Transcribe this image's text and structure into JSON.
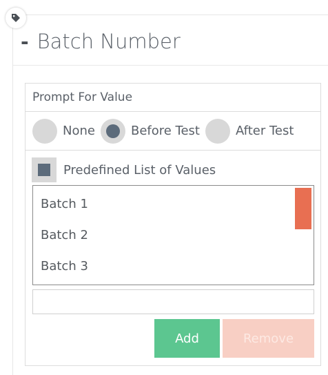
{
  "section": {
    "collapse_symbol": "-",
    "title": "Batch Number",
    "icon": "tag-icon"
  },
  "prompt": {
    "label": "Prompt For Value",
    "options": [
      {
        "label": "None",
        "selected": false
      },
      {
        "label": "Before Test",
        "selected": true
      },
      {
        "label": "After Test",
        "selected": false
      }
    ]
  },
  "predefined": {
    "label": "Predefined List of Values",
    "checked": true,
    "items": [
      "Batch 1",
      "Batch 2",
      "Batch 3"
    ]
  },
  "new_value": {
    "value": "",
    "placeholder": ""
  },
  "buttons": {
    "add_label": "Add",
    "remove_label": "Remove"
  },
  "colors": {
    "accent_add": "#5cc690",
    "accent_remove_disabled": "#f8cfc4",
    "scrollbar_thumb": "#e86f52",
    "selected_control": "#5c6b7b"
  }
}
